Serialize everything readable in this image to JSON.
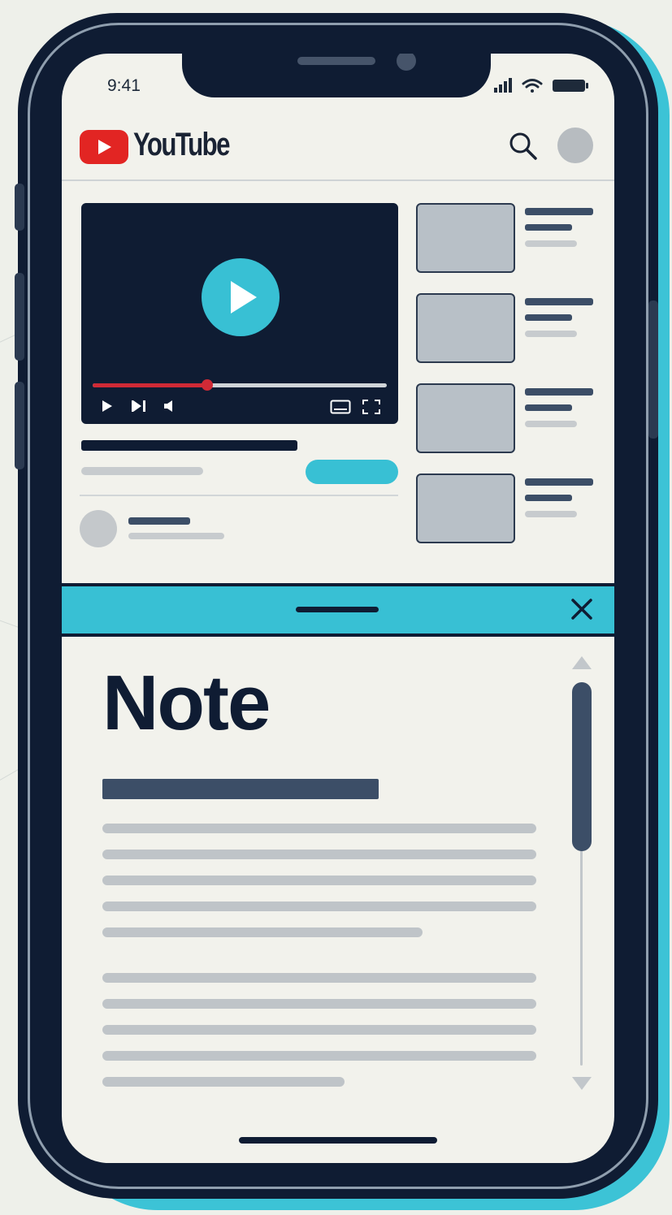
{
  "status_bar": {
    "time": "9:41"
  },
  "app": {
    "brand": "YouTube"
  },
  "video": {
    "progress": 0.39
  },
  "note": {
    "title": "Note"
  },
  "icons": [
    "play-icon",
    "next-icon",
    "volume-icon",
    "captions-icon",
    "fullscreen-icon",
    "search-icon",
    "close-icon",
    "signal-icon",
    "wifi-icon",
    "battery-icon"
  ],
  "colors": {
    "accent": "#38c0d4",
    "brand_red": "#e22523",
    "navy": "#0f1c33",
    "progress_red": "#d02a36"
  }
}
